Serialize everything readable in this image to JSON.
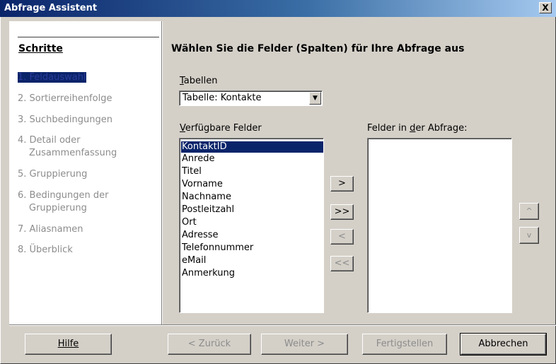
{
  "window": {
    "title": "Abfrage Assistent",
    "close_label": "X"
  },
  "steps": {
    "title": "Schritte",
    "items": [
      {
        "label": "1. Feldauswahl",
        "active": true
      },
      {
        "label": "2. Sortierreihenfolge",
        "active": false
      },
      {
        "label": "3. Suchbedingungen",
        "active": false
      },
      {
        "label": "4. Detail oder",
        "active": false
      },
      {
        "label": "Zusammenfassung",
        "active": false
      },
      {
        "label": "5. Gruppierung",
        "active": false
      },
      {
        "label": "6. Bedingungen der",
        "active": false
      },
      {
        "label": "Gruppierung",
        "active": false
      },
      {
        "label": "7. Aliasnamen",
        "active": false
      },
      {
        "label": "8. Überblick",
        "active": false
      }
    ]
  },
  "main": {
    "heading": "Wählen Sie die Felder (Spalten) für Ihre Abfrage aus",
    "tables_label_first": "T",
    "tables_label_rest": "abellen",
    "tables_value": "Tabelle: Kontakte",
    "available_label_first": "V",
    "available_label_rest": "erfügbare Felder",
    "query_fields_label_a": "Felder in ",
    "query_fields_label_u": "d",
    "query_fields_label_b": "er Abfrage:",
    "available_fields": [
      "KontaktID",
      "Anrede",
      "Titel",
      "Vorname",
      "Nachname",
      "Postleitzahl",
      "Ort",
      "Adresse",
      "Telefonnummer",
      "eMail",
      "Anmerkung"
    ],
    "selected_field": "KontaktID",
    "move_buttons": {
      "add": ">",
      "add_all": ">>",
      "remove": "<",
      "remove_all": "<<"
    },
    "order_buttons": {
      "up": "^",
      "down": "v"
    }
  },
  "footer": {
    "help": "Hilfe",
    "back": "< Zurück",
    "next": "Weiter >",
    "finish": "Fertigstellen",
    "cancel": "Abbrechen"
  }
}
